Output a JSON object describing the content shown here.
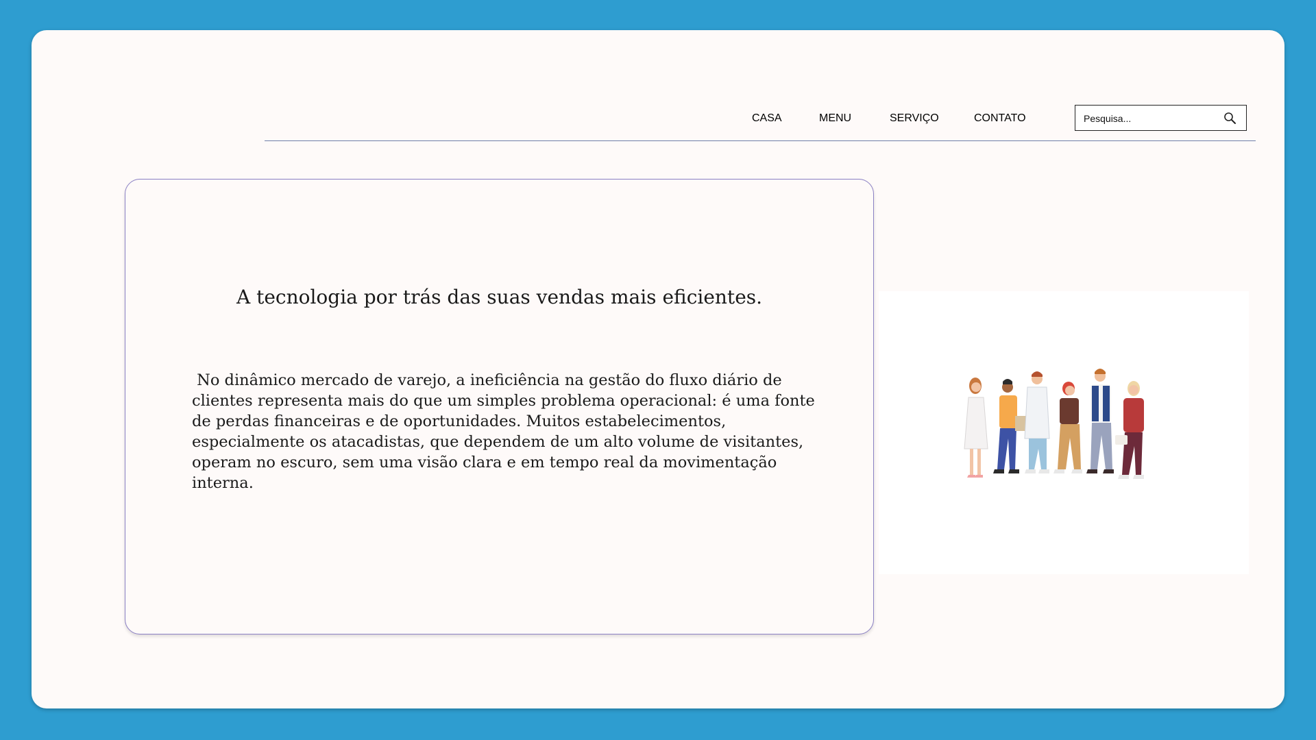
{
  "nav": {
    "items": [
      {
        "label": "CASA"
      },
      {
        "label": "MENU"
      },
      {
        "label": "SERVIÇO"
      },
      {
        "label": "CONTATO"
      }
    ]
  },
  "search": {
    "placeholder": "Pesquisa...",
    "icon": "search-icon"
  },
  "hero": {
    "title": "A tecnologia por trás das suas vendas mais eficientes.",
    "body": " No dinâmico mercado de varejo, a ineficiência na gestão do fluxo diário de\nclientes representa mais do que um simples problema operacional: é uma fonte\nde perdas financeiras e de oportunidades. Muitos estabelecimentos,\nespecialmente os atacadistas, que dependem de um alto volume de visitantes,\noperam no escuro, sem uma visão clara e em tempo real da movimentação\ninterna."
  },
  "illustration": {
    "icon": "people-group-illustration"
  },
  "colors": {
    "background": "#2e9dd0",
    "page": "#fefaf9",
    "card_border": "#8a7fc4",
    "nav_line": "#6f7fa8"
  }
}
